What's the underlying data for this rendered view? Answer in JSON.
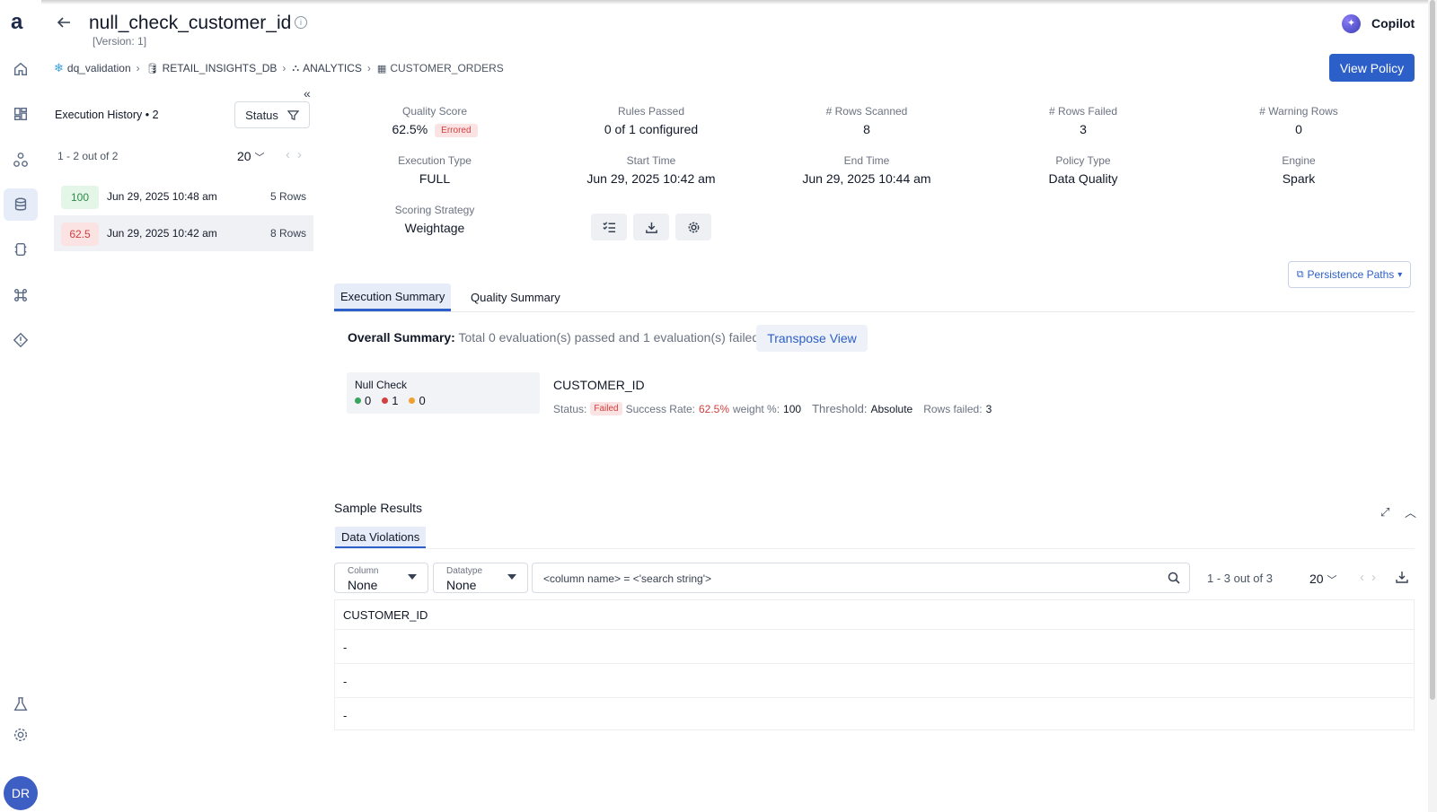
{
  "app": {
    "logo": "a",
    "user_initials": "DR"
  },
  "page": {
    "title": "null_check_customer_id",
    "version": "[Version: 1]",
    "back_icon": "arrow-left-icon"
  },
  "copilot": {
    "label": "Copilot"
  },
  "view_policy": {
    "label": "View Policy"
  },
  "breadcrumbs": [
    {
      "label": "dq_validation",
      "icon": "snowflake-icon"
    },
    {
      "label": "RETAIL_INSIGHTS_DB",
      "icon": "database-icon"
    },
    {
      "label": "ANALYTICS",
      "icon": "schema-icon"
    },
    {
      "label": "CUSTOMER_ORDERS",
      "icon": "table-icon"
    }
  ],
  "history": {
    "title": "Execution History",
    "count": "2",
    "status_label": "Status",
    "range": "1 - 2 out of 2",
    "page_size": "20",
    "rows": [
      {
        "score": "100",
        "date": "Jun 29, 2025 10:48 am",
        "rows": "5 Rows",
        "status": "success"
      },
      {
        "score": "62.5",
        "date": "Jun 29, 2025 10:42 am",
        "rows": "8 Rows",
        "status": "error"
      }
    ]
  },
  "metrics": {
    "quality_score": {
      "label": "Quality Score",
      "value": "62.5%",
      "badge": "Errored"
    },
    "rules_passed": {
      "label": "Rules Passed",
      "value": "0 of 1 configured"
    },
    "rows_scanned": {
      "label": "# Rows Scanned",
      "value": "8"
    },
    "rows_failed": {
      "label": "# Rows Failed",
      "value": "3"
    },
    "warning_rows": {
      "label": "# Warning Rows",
      "value": "0"
    },
    "execution_type": {
      "label": "Execution Type",
      "value": "FULL"
    },
    "start_time": {
      "label": "Start Time",
      "value": "Jun 29, 2025 10:42 am"
    },
    "end_time": {
      "label": "End Time",
      "value": "Jun 29, 2025 10:44 am"
    },
    "policy_type": {
      "label": "Policy Type",
      "value": "Data Quality"
    },
    "engine": {
      "label": "Engine",
      "value": "Spark"
    },
    "scoring_strategy": {
      "label": "Scoring Strategy",
      "value": "Weightage"
    }
  },
  "persistence": {
    "label": "Persistence Paths"
  },
  "tabs": {
    "execution_summary": "Execution Summary",
    "quality_summary": "Quality Summary"
  },
  "summary": {
    "label": "Overall Summary:",
    "text": "Total 0 evaluation(s) passed and 1 evaluation(s) failed.",
    "transpose": "Transpose View"
  },
  "rule": {
    "name": "Null Check",
    "passed": "0",
    "failed": "1",
    "warning": "0",
    "column": "CUSTOMER_ID",
    "status_label": "Status:",
    "status": "Failed",
    "success_rate_label": "Success Rate:",
    "success_rate": "62.5%",
    "weight_label": "weight %:",
    "weight": "100",
    "threshold_label": "Threshold:",
    "threshold": "Absolute",
    "rows_failed_label": "Rows failed:",
    "rows_failed": "3"
  },
  "sample": {
    "title": "Sample Results",
    "tab": "Data Violations",
    "column_label": "Column",
    "column_value": "None",
    "datatype_label": "Datatype",
    "datatype_value": "None",
    "search_placeholder": "<column name> = <'search string'>",
    "range": "1 - 3 out of 3",
    "page_size": "20",
    "header": "CUSTOMER_ID",
    "rows": [
      "-",
      "-",
      "-"
    ]
  },
  "colors": {
    "primary": "#2d5fc8",
    "error": "#d23f3f",
    "success": "#2e8b4a",
    "warning": "#f0a030"
  }
}
